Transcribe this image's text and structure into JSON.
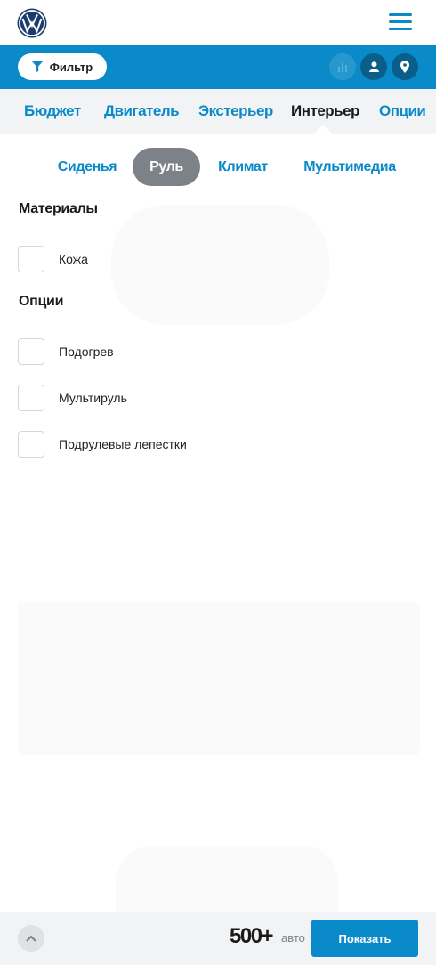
{
  "header": {
    "logo": "volkswagen-logo",
    "menu_icon": "hamburger-icon"
  },
  "toolbar": {
    "filter_label": "Фильтр",
    "filter_icon": "filter-icon",
    "icons": [
      "chart-icon",
      "user-icon",
      "map-pin-icon"
    ]
  },
  "main_tabs": [
    {
      "label": "Бюджет",
      "active": false
    },
    {
      "label": "Двигатель",
      "active": false
    },
    {
      "label": "Экстерьер",
      "active": false
    },
    {
      "label": "Интерьер",
      "active": true
    },
    {
      "label": "Опции",
      "active": false
    }
  ],
  "sub_tabs": [
    {
      "label": "Сиденья",
      "active": false
    },
    {
      "label": "Руль",
      "active": true
    },
    {
      "label": "Климат",
      "active": false
    },
    {
      "label": "Мультимедиа",
      "active": false
    }
  ],
  "sections": [
    {
      "title": "Материалы",
      "options": [
        {
          "label": "Кожа",
          "checked": false
        }
      ]
    },
    {
      "title": "Опции",
      "options": [
        {
          "label": "Подогрев",
          "checked": false
        },
        {
          "label": "Мультируль",
          "checked": false
        },
        {
          "label": "Подрулевые лепестки",
          "checked": false
        }
      ]
    }
  ],
  "footer": {
    "count": "500+",
    "count_unit": "авто",
    "show_label": "Показать",
    "up_icon": "chevron-up-icon"
  },
  "colors": {
    "accent": "#0a8ac8",
    "dark_accent": "#0a5e8a",
    "active_subtab": "#7c8288",
    "tab_bg": "#f2f3f5"
  }
}
